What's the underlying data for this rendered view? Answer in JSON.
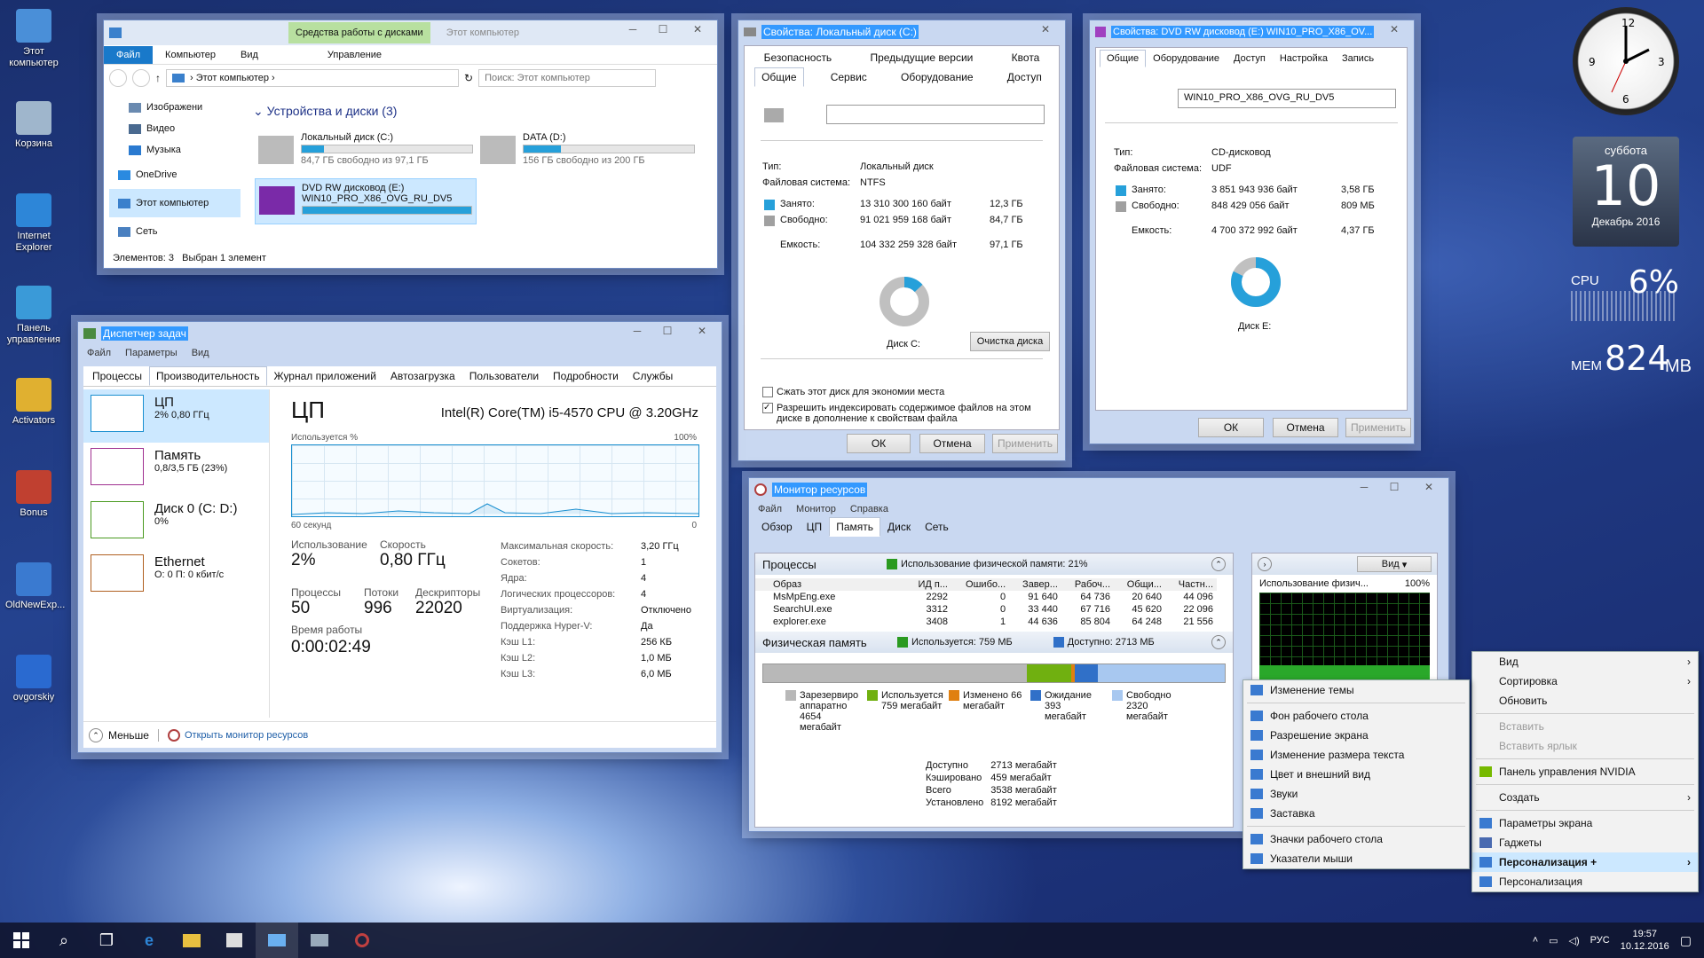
{
  "desktop": {
    "icons": [
      {
        "label": "Этот компьютер",
        "name": "this-pc-icon",
        "color": "#4a8fd8"
      },
      {
        "label": "Корзина",
        "name": "recycle-bin-icon",
        "color": "#9fb6cc"
      },
      {
        "label": "Internet Explorer",
        "name": "ie-icon",
        "color": "#2d86d8"
      },
      {
        "label": "Панель управления",
        "name": "control-panel-icon",
        "color": "#3a9ad8"
      },
      {
        "label": "Activators",
        "name": "activators-icon",
        "color": "#e0b030"
      },
      {
        "label": "Bonus",
        "name": "bonus-icon",
        "color": "#c04030"
      },
      {
        "label": "OldNewExp...",
        "name": "oldnewexp-icon",
        "color": "#3a7ad0"
      },
      {
        "label": "ovgorskiy",
        "name": "ovgorskiy-icon",
        "color": "#2a6ad0"
      }
    ]
  },
  "explorer": {
    "context_tab": "Средства работы с дисками",
    "title": "Этот компьютер",
    "ribbon": [
      "Файл",
      "Компьютер",
      "Вид",
      "Управление"
    ],
    "address": "Этот компьютер",
    "search_placeholder": "Поиск: Этот компьютер",
    "nav": [
      "Изображени",
      "Видео",
      "Музыка",
      "OneDrive",
      "Этот компьютер",
      "Сеть"
    ],
    "group": "Устройства и диски (3)",
    "drives": [
      {
        "name": "Локальный диск (C:)",
        "free": "84,7 ГБ свободно из 97,1 ГБ",
        "fill": 0.13
      },
      {
        "name": "DATA (D:)",
        "free": "156 ГБ свободно из 200 ГБ",
        "fill": 0.22
      },
      {
        "name": "DVD RW дисковод (E:)",
        "label2": "WIN10_PRO_X86_OVG_RU_DV5",
        "fill": 1.0
      }
    ],
    "status_items": "Элементов: 3",
    "status_selected": "Выбран 1 элемент"
  },
  "propC": {
    "title": "Свойства: Локальный диск (C:)",
    "tabs_row1": [
      "Безопасность",
      "Предыдущие версии",
      "Квота"
    ],
    "tabs_row2": [
      "Общие",
      "Сервис",
      "Оборудование",
      "Доступ"
    ],
    "type_label": "Тип:",
    "type_value": "Локальный диск",
    "fs_label": "Файловая система:",
    "fs_value": "NTFS",
    "used_label": "Занято:",
    "used_bytes": "13 310 300 160 байт",
    "used_gb": "12,3 ГБ",
    "free_label": "Свободно:",
    "free_bytes": "91 021 959 168 байт",
    "free_gb": "84,7 ГБ",
    "cap_label": "Емкость:",
    "cap_bytes": "104 332 259 328 байт",
    "cap_gb": "97,1 ГБ",
    "disk_label": "Диск C:",
    "cleanup": "Очистка диска",
    "compress": "Сжать этот диск для экономии места",
    "index": "Разрешить индексировать содержимое файлов на этом диске в дополнение к свойствам файла",
    "ok": "ОК",
    "cancel": "Отмена",
    "apply": "Применить",
    "used_fraction": 0.13
  },
  "propE": {
    "title": "Свойства: DVD RW дисковод (E:) WIN10_PRO_X86_OV...",
    "tabs": [
      "Общие",
      "Оборудование",
      "Доступ",
      "Настройка",
      "Запись"
    ],
    "label_value": "WIN10_PRO_X86_OVG_RU_DV5",
    "type_label": "Тип:",
    "type_value": "CD-дисковод",
    "fs_label": "Файловая система:",
    "fs_value": "UDF",
    "used_label": "Занято:",
    "used_bytes": "3 851 943 936 байт",
    "used_gb": "3,58 ГБ",
    "free_label": "Свободно:",
    "free_bytes": "848 429 056 байт",
    "free_gb": "809 МБ",
    "cap_label": "Емкость:",
    "cap_bytes": "4 700 372 992 байт",
    "cap_gb": "4,37 ГБ",
    "disk_label": "Диск E:",
    "ok": "ОК",
    "cancel": "Отмена",
    "apply": "Применить",
    "used_fraction": 0.82
  },
  "taskmgr": {
    "title": "Диспетчер задач",
    "menu": [
      "Файл",
      "Параметры",
      "Вид"
    ],
    "tabs": [
      "Процессы",
      "Производительность",
      "Журнал приложений",
      "Автозагрузка",
      "Пользователи",
      "Подробности",
      "Службы"
    ],
    "side": [
      {
        "name": "ЦП",
        "sub": "2% 0,80 ГГц",
        "color": "#1a8fd0"
      },
      {
        "name": "Память",
        "sub": "0,8/3,5 ГБ (23%)",
        "color": "#a03090"
      },
      {
        "name": "Диск 0 (C: D:)",
        "sub": "0%",
        "color": "#4a9a20"
      },
      {
        "name": "Ethernet",
        "sub": "О: 0 П: 0 кбит/с",
        "color": "#b06020"
      }
    ],
    "heading": "ЦП",
    "cpu_model": "Intel(R) Core(TM) i5-4570 CPU @ 3.20GHz",
    "usage_label": "Используется %",
    "max_label": "100%",
    "time_label": "60 секунд",
    "zero": "0",
    "stats": [
      {
        "l": "Использование",
        "v": "2%"
      },
      {
        "l": "Скорость",
        "v": "0,80 ГГц"
      },
      {
        "l": "Процессы",
        "v": "50"
      },
      {
        "l": "Потоки",
        "v": "996"
      },
      {
        "l": "Дескрипторы",
        "v": "22020"
      }
    ],
    "uptime_label": "Время работы",
    "uptime": "0:00:02:49",
    "specs": [
      [
        "Максимальная скорость:",
        "3,20 ГГц"
      ],
      [
        "Сокетов:",
        "1"
      ],
      [
        "Ядра:",
        "4"
      ],
      [
        "Логических процессоров:",
        "4"
      ],
      [
        "Виртуализация:",
        "Отключено"
      ],
      [
        "Поддержка Hyper-V:",
        "Да"
      ],
      [
        "Кэш L1:",
        "256 КБ"
      ],
      [
        "Кэш L2:",
        "1,0 МБ"
      ],
      [
        "Кэш L3:",
        "6,0 МБ"
      ]
    ],
    "less": "Меньше",
    "open_monitor": "Открыть монитор ресурсов"
  },
  "resmon": {
    "title": "Монитор ресурсов",
    "menu": [
      "Файл",
      "Монитор",
      "Справка"
    ],
    "tabs": [
      "Обзор",
      "ЦП",
      "Память",
      "Диск",
      "Сеть"
    ],
    "proc_header": "Процессы",
    "phys_usage": "Использование физической памяти: 21%",
    "cols": [
      "Образ",
      "ИД п...",
      "Ошибо...",
      "Завер...",
      "Рабоч...",
      "Общи...",
      "Частн..."
    ],
    "rows": [
      [
        "MsMpEng.exe",
        "2292",
        "0",
        "91 640",
        "64 736",
        "20 640",
        "44 096"
      ],
      [
        "SearchUI.exe",
        "3312",
        "0",
        "33 440",
        "67 716",
        "45 620",
        "22 096"
      ],
      [
        "explorer.exe",
        "3408",
        "1",
        "44 636",
        "85 804",
        "64 248",
        "21 556"
      ]
    ],
    "phys_header": "Физическая память",
    "in_use": "Используется: 759 МБ",
    "available": "Доступно: 2713 МБ",
    "legend": [
      {
        "t": "Зарезервиро аппаратно 4654 мегабайт",
        "c": "#b8b8b8"
      },
      {
        "t": "Используется 759 мегабайт",
        "c": "#70b010"
      },
      {
        "t": "Изменено 66 мегабайт",
        "c": "#e08010"
      },
      {
        "t": "Ожидание 393 мегабайт",
        "c": "#3070c8"
      },
      {
        "t": "Свободно 2320 мегабайт",
        "c": "#a8c8f0"
      }
    ],
    "summary": [
      [
        "Доступно",
        "2713 мегабайт"
      ],
      [
        "Кэшировано",
        "459 мегабайт"
      ],
      [
        "Всего",
        "3538 мегабайт"
      ],
      [
        "Установлено",
        "8192 мегабайт"
      ]
    ],
    "view_btn": "Вид",
    "graph_label": "Использование физич...",
    "graph_max": "100%"
  },
  "gadgets": {
    "day": "суббота",
    "date": "10",
    "month": "Декабрь 2016",
    "cpu_label": "CPU",
    "cpu_value": "6%",
    "mem_label": "MEM",
    "mem_value": "824",
    "mem_unit": "MB"
  },
  "ctx_main": [
    {
      "t": "Вид",
      "arrow": true
    },
    {
      "t": "Сортировка",
      "arrow": true
    },
    {
      "t": "Обновить"
    },
    {
      "sep": true
    },
    {
      "t": "Вставить",
      "dis": true
    },
    {
      "t": "Вставить ярлык",
      "dis": true
    },
    {
      "sep": true
    },
    {
      "t": "Панель управления NVIDIA",
      "icon": "#76b900"
    },
    {
      "sep": true
    },
    {
      "t": "Создать",
      "arrow": true
    },
    {
      "sep": true
    },
    {
      "t": "Параметры экрана",
      "icon": "#3a7ad0"
    },
    {
      "t": "Гаджеты",
      "icon": "#4a6ab0"
    },
    {
      "t": "Персонализация +",
      "icon": "#3a7ad0",
      "hl": true,
      "arrow": true
    },
    {
      "t": "Персонализация",
      "icon": "#3a7ad0"
    }
  ],
  "ctx_sub": [
    {
      "t": "Изменение темы"
    },
    {
      "sep": true
    },
    {
      "t": "Фон рабочего стола"
    },
    {
      "t": "Разрешение экрана"
    },
    {
      "t": "Изменение размера текста"
    },
    {
      "t": "Цвет и внешний вид"
    },
    {
      "t": "Звуки"
    },
    {
      "t": "Заставка"
    },
    {
      "sep": true
    },
    {
      "t": "Значки рабочего стола"
    },
    {
      "t": "Указатели мыши"
    }
  ],
  "taskbar": {
    "lang": "РУС",
    "time": "19:57",
    "date": "10.12.2016"
  }
}
